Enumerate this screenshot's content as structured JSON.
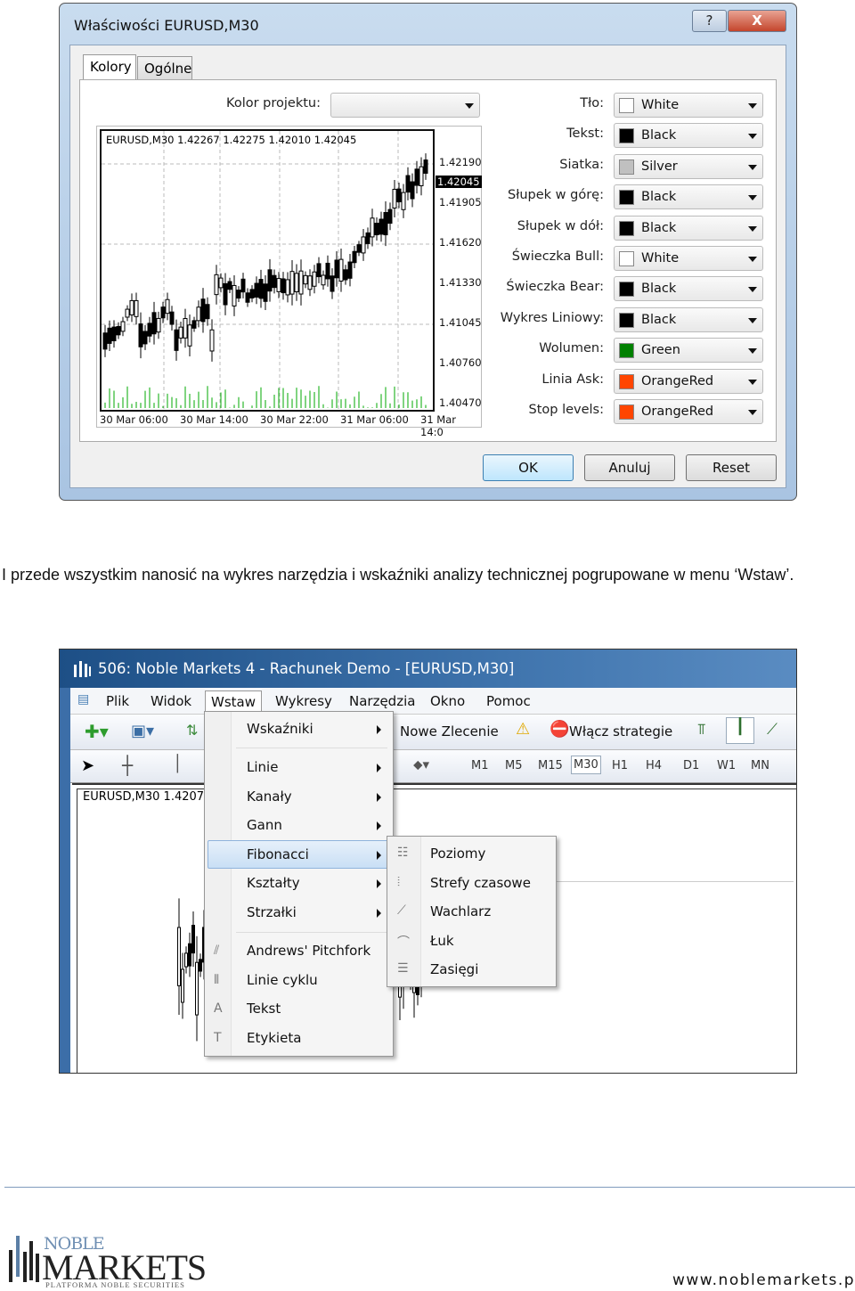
{
  "dialog": {
    "title": "Właściwości EURUSD,M30",
    "help_label": "?",
    "close_label": "X",
    "tabs": [
      {
        "label": "Kolory",
        "active": true
      },
      {
        "label": "Ogólne",
        "active": false
      }
    ],
    "color_scheme_label": "Kolor projektu:",
    "color_scheme_value": "",
    "preview": {
      "header": "EURUSD,M30  1.42267 1.42275 1.42010 1.42045",
      "price_labels": [
        "1.42190",
        "1.42045",
        "1.41905",
        "1.41620",
        "1.41330",
        "1.41045",
        "1.40760",
        "1.40470"
      ],
      "current_price": "1.42045",
      "time_labels": [
        "30 Mar 06:00",
        "30 Mar 14:00",
        "30 Mar 22:00",
        "31 Mar 06:00",
        "31 Mar 14:0"
      ]
    },
    "colors": [
      {
        "label": "Tło:",
        "value": "White",
        "swatch": "#ffffff"
      },
      {
        "label": "Tekst:",
        "value": "Black",
        "swatch": "#000000"
      },
      {
        "label": "Siatka:",
        "value": "Silver",
        "swatch": "#c0c0c0"
      },
      {
        "label": "Słupek w górę:",
        "value": "Black",
        "swatch": "#000000"
      },
      {
        "label": "Słupek w dół:",
        "value": "Black",
        "swatch": "#000000"
      },
      {
        "label": "Świeczka Bull:",
        "value": "White",
        "swatch": "#ffffff"
      },
      {
        "label": "Świeczka Bear:",
        "value": "Black",
        "swatch": "#000000"
      },
      {
        "label": "Wykres Liniowy:",
        "value": "Black",
        "swatch": "#000000"
      },
      {
        "label": "Wolumen:",
        "value": "Green",
        "swatch": "#008000"
      },
      {
        "label": "Linia Ask:",
        "value": "OrangeRed",
        "swatch": "#ff4500"
      },
      {
        "label": "Stop levels:",
        "value": "OrangeRed",
        "swatch": "#ff4500"
      }
    ],
    "buttons": {
      "ok": "OK",
      "cancel": "Anuluj",
      "reset": "Reset"
    }
  },
  "paragraph": "I przede wszystkim nanosić na wykres narzędzia i wskaźniki analizy technicznej pogrupowane w menu ‘Wstaw’.",
  "terminal": {
    "title": "506: Noble Markets 4 - Rachunek Demo - [EURUSD,M30]",
    "menu": [
      "Plik",
      "Widok",
      "Wstaw",
      "Wykresy",
      "Narzędzia",
      "Okno",
      "Pomoc"
    ],
    "toolbar": {
      "new_order": "Nowe Zlecenie",
      "strategies": "Włącz strategie"
    },
    "timeframes": [
      "M1",
      "M5",
      "M15",
      "M30",
      "H1",
      "H4",
      "D1",
      "W1",
      "MN"
    ],
    "active_timeframe": "M30",
    "chart_header": "EURUSD,M30  1.4207",
    "insert_menu": [
      {
        "label": "Wskaźniki",
        "submenu": true
      },
      {
        "label": "Linie",
        "submenu": true
      },
      {
        "label": "Kanały",
        "submenu": true
      },
      {
        "label": "Gann",
        "submenu": true
      },
      {
        "label": "Fibonacci",
        "submenu": true,
        "highlighted": true
      },
      {
        "label": "Kształty",
        "submenu": true
      },
      {
        "label": "Strzałki",
        "submenu": true
      },
      {
        "label": "Andrews' Pitchfork",
        "icon": "pitchfork-icon"
      },
      {
        "label": "Linie cyklu",
        "icon": "cycle-lines-icon"
      },
      {
        "label": "Tekst",
        "icon": "text-icon"
      },
      {
        "label": "Etykieta",
        "icon": "label-icon"
      }
    ],
    "fibonacci_submenu": [
      "Poziomy",
      "Strefy czasowe",
      "Wachlarz",
      "Łuk",
      "Zasięgi"
    ]
  },
  "footer": {
    "logo": {
      "line1": "NOBLE",
      "line2": "MARKETS",
      "tagline": "PLATFORMA NOBLE SECURITIES"
    },
    "website": "www.noblemarkets.pl"
  }
}
